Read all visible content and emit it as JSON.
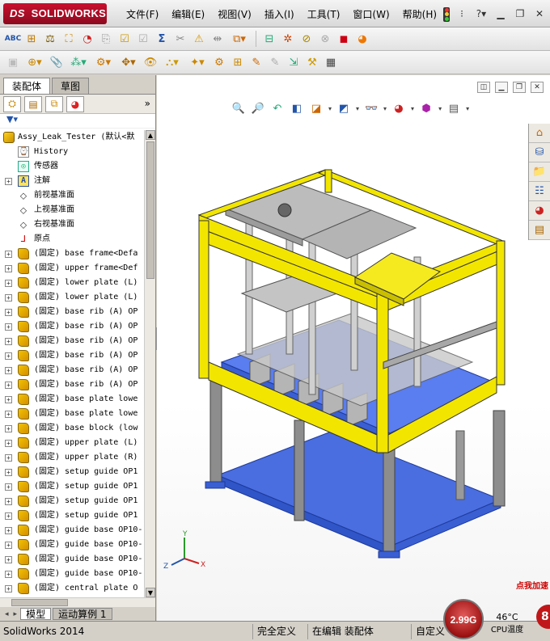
{
  "app": {
    "brand": "SOLIDWORKS",
    "brand_prefix": "DS"
  },
  "menu": [
    "文件(F)",
    "编辑(E)",
    "视图(V)",
    "插入(I)",
    "工具(T)",
    "窗口(W)",
    "帮助(H)"
  ],
  "panel": {
    "tabs": [
      "装配体",
      "草图"
    ],
    "active_tab": "装配体",
    "filter_icon": "funnel-icon",
    "bottom_tabs": [
      "模型",
      "运动算例 1"
    ]
  },
  "tree": {
    "root": "Assy_Leak_Tester  (默认<默",
    "items": [
      {
        "type": "history",
        "label": "History",
        "expand": false
      },
      {
        "type": "sensor",
        "label": "传感器",
        "expand": false
      },
      {
        "type": "annot",
        "label": "注解",
        "expand": true
      },
      {
        "type": "plane",
        "label": "前视基准面",
        "expand": false
      },
      {
        "type": "plane",
        "label": "上视基准面",
        "expand": false
      },
      {
        "type": "plane",
        "label": "右视基准面",
        "expand": false
      },
      {
        "type": "origin",
        "label": "原点",
        "expand": false
      },
      {
        "type": "part",
        "label": "(固定) base frame<Defa",
        "expand": true
      },
      {
        "type": "part",
        "label": "(固定) upper frame<Def",
        "expand": true
      },
      {
        "type": "part",
        "label": "(固定) lower plate (L)",
        "expand": true
      },
      {
        "type": "part",
        "label": "(固定) lower plate (L)",
        "expand": true
      },
      {
        "type": "part",
        "label": "(固定) base rib (A) OP",
        "expand": true
      },
      {
        "type": "part",
        "label": "(固定) base rib (A) OP",
        "expand": true
      },
      {
        "type": "part",
        "label": "(固定) base rib (A) OP",
        "expand": true
      },
      {
        "type": "part",
        "label": "(固定) base rib (A) OP",
        "expand": true
      },
      {
        "type": "part",
        "label": "(固定) base rib (A) OP",
        "expand": true
      },
      {
        "type": "part",
        "label": "(固定) base rib (A) OP",
        "expand": true
      },
      {
        "type": "part",
        "label": "(固定) base plate lowe",
        "expand": true
      },
      {
        "type": "part",
        "label": "(固定) base plate lowe",
        "expand": true
      },
      {
        "type": "part",
        "label": "(固定) base block (low",
        "expand": true
      },
      {
        "type": "part",
        "label": "(固定) upper plate (L)",
        "expand": true
      },
      {
        "type": "part",
        "label": "(固定) upper plate (R)",
        "expand": true
      },
      {
        "type": "part",
        "label": "(固定) setup guide OP1",
        "expand": true
      },
      {
        "type": "part",
        "label": "(固定) setup guide OP1",
        "expand": true
      },
      {
        "type": "part",
        "label": "(固定) setup guide OP1",
        "expand": true
      },
      {
        "type": "part",
        "label": "(固定) setup guide OP1",
        "expand": true
      },
      {
        "type": "part",
        "label": "(固定) guide base OP10-",
        "expand": true
      },
      {
        "type": "part",
        "label": "(固定) guide base OP10-",
        "expand": true
      },
      {
        "type": "part",
        "label": "(固定) guide base OP10-",
        "expand": true
      },
      {
        "type": "part",
        "label": "(固定) guide base OP10-",
        "expand": true
      },
      {
        "type": "part",
        "label": "(固定) central plate O",
        "expand": true
      }
    ]
  },
  "triad": {
    "y": "Y",
    "x": "X",
    "z": "Z"
  },
  "promo": "点我加速",
  "status": {
    "app_version": "SolidWorks 2014",
    "definition": "完全定义",
    "editing": "在编辑 装配体",
    "custom": "自定义",
    "cpu_value": "2.99G",
    "temperature": "46°C",
    "temp_label": "CPU温度",
    "badge_num": "8"
  },
  "colors": {
    "frame_yellow": "#f2e600",
    "base_blue": "#4a6ee0",
    "steel_gray": "#9a9a9a",
    "brand_red": "#c8102e"
  }
}
